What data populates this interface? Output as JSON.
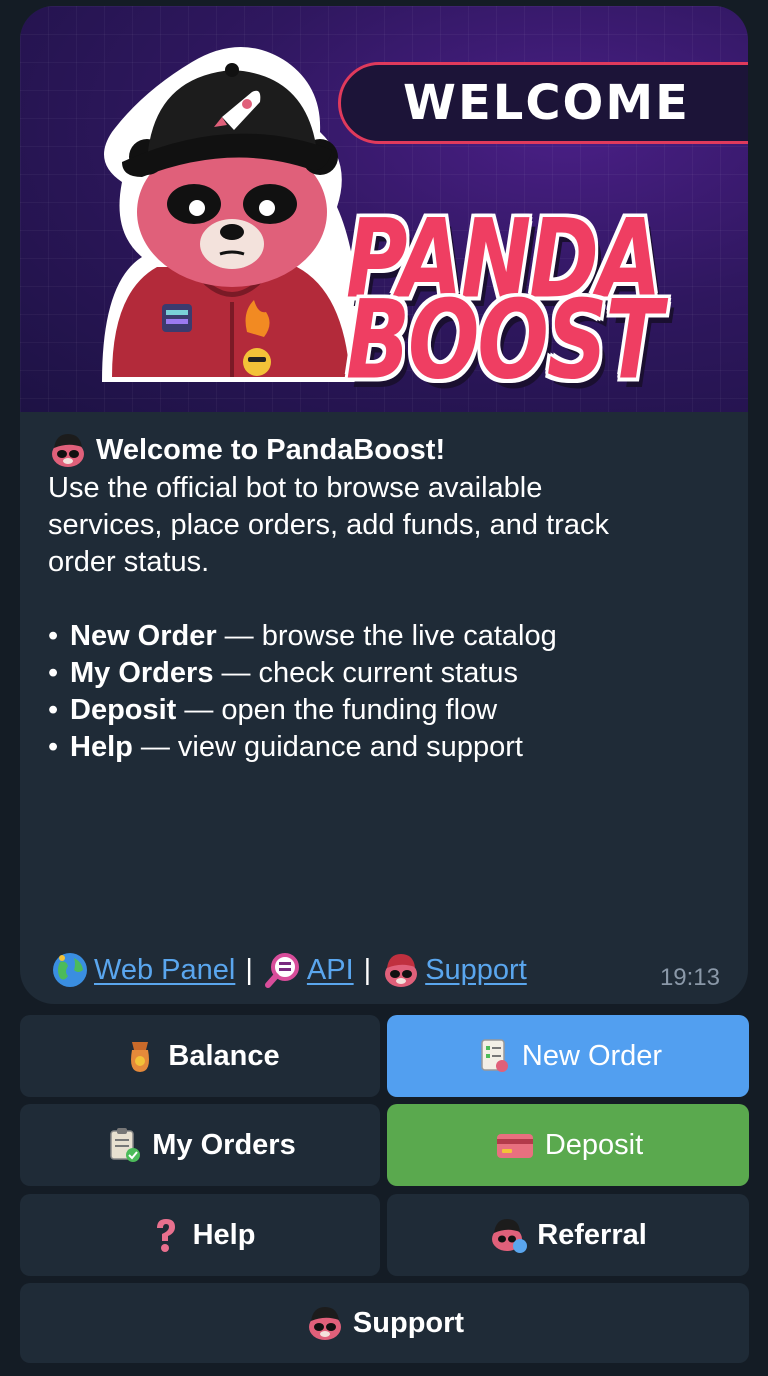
{
  "banner": {
    "welcome": "WELCOME",
    "brand_line1": "PANDA",
    "brand_line2": "BOOST"
  },
  "message": {
    "title": "Welcome to PandaBoost!",
    "body": [
      "Use the official bot to browse available",
      "services, place orders, add funds, and track",
      "order status."
    ],
    "bullets": [
      {
        "label": "New Order",
        "text": "— browse the live catalog"
      },
      {
        "label": "My Orders",
        "text": "— check current status"
      },
      {
        "label": "Deposit",
        "text": "— open the funding flow"
      },
      {
        "label": "Help",
        "text": "— view guidance and support"
      }
    ],
    "links": [
      {
        "label": "Web Panel",
        "icon": "globe-icon"
      },
      {
        "label": "API",
        "icon": "magnifier-icon"
      },
      {
        "label": "Support",
        "icon": "panda-icon"
      }
    ],
    "separator": "|",
    "time": "19:13"
  },
  "keyboard": {
    "balance": "Balance",
    "new_order": "New Order",
    "my_orders": "My Orders",
    "deposit": "Deposit",
    "help": "Help",
    "referral": "Referral",
    "support": "Support"
  },
  "colors": {
    "background": "#141c25",
    "bubble": "#1f2b37",
    "link": "#5aa6ee",
    "new_order_button": "#529ff0",
    "deposit_button": "#5aa94e",
    "brand": "#ef3e62"
  }
}
